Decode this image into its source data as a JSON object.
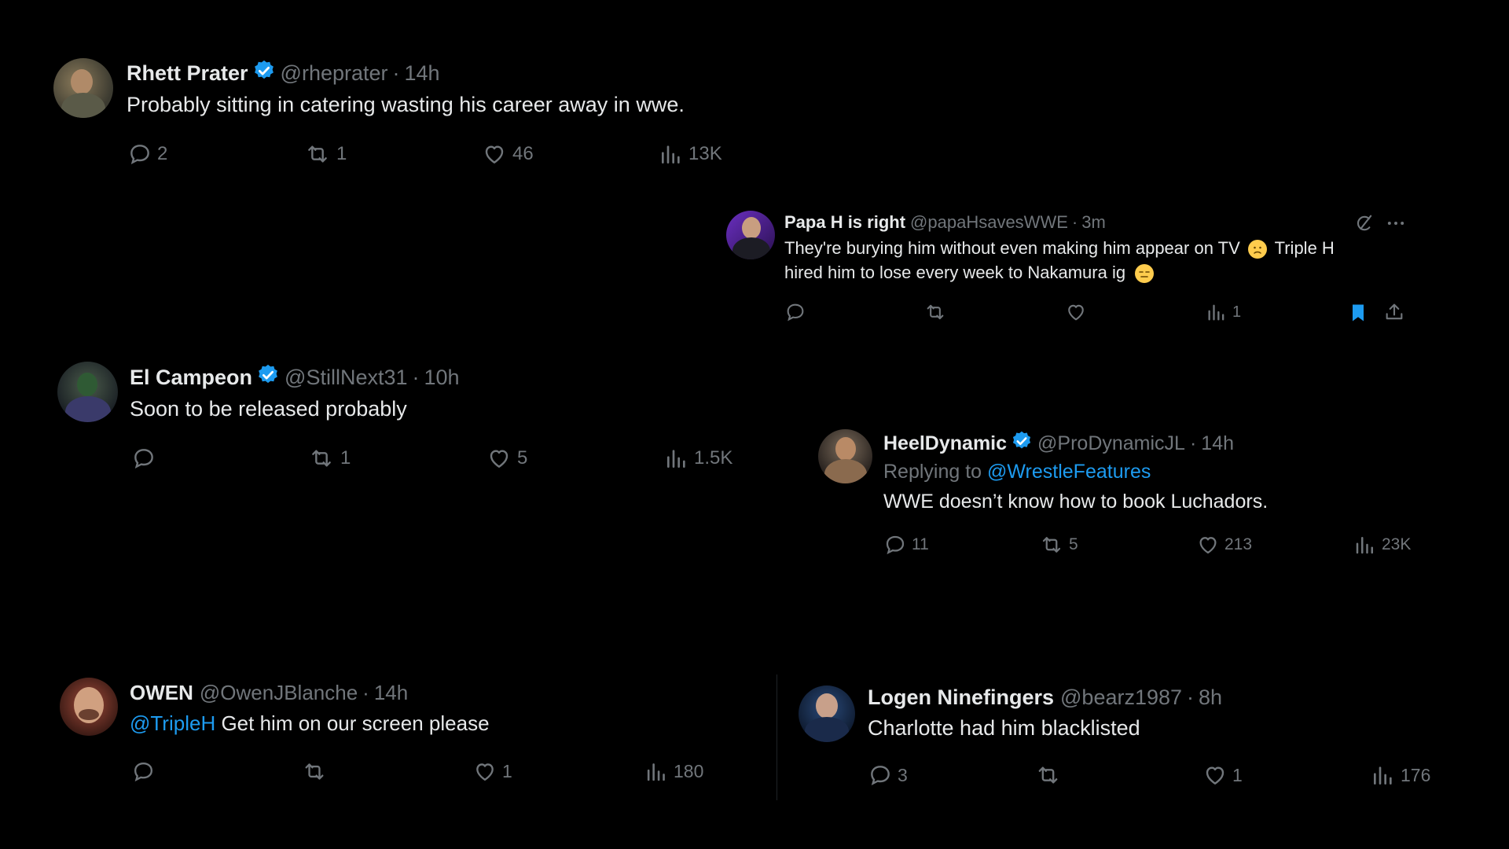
{
  "colors": {
    "background": "#000000",
    "text": "#e7e9ea",
    "muted": "#71767b",
    "accent": "#1d9bf0"
  },
  "tweets": [
    {
      "name": "Rhett Prater",
      "verified": true,
      "handle": "@rheprater",
      "sep": "·",
      "time": "14h",
      "text": "Probably sitting in catering wasting his career away in wwe.",
      "replies": "2",
      "retweets": "1",
      "likes": "46",
      "views": "13K"
    },
    {
      "name": "Papa H is right",
      "verified": false,
      "handle": "@papaHsavesWWE",
      "sep": "·",
      "time": "3m",
      "text_line1_a": "They're burying him without even making him appear on TV",
      "text_line1_b": "Triple H",
      "text_line2": "hired him to lose every week to Nakamura ig",
      "replies": "",
      "retweets": "",
      "likes": "",
      "views": "1",
      "icons": [
        "grok-icon",
        "more-icon",
        "bookmark-filled-icon",
        "share-icon"
      ]
    },
    {
      "name": "El Campeon",
      "verified": true,
      "handle": "@StillNext31",
      "sep": "·",
      "time": "10h",
      "text": "Soon to be released probably",
      "replies": "",
      "retweets": "1",
      "likes": "5",
      "views": "1.5K"
    },
    {
      "name": "HeelDynamic",
      "verified": true,
      "handle": "@ProDynamicJL",
      "sep": "·",
      "time": "14h",
      "replying_prefix": "Replying to",
      "replying_to": "@WrestleFeatures",
      "text": "WWE doesn’t know how to book Luchadors.",
      "replies": "11",
      "retweets": "5",
      "likes": "213",
      "views": "23K"
    },
    {
      "name": "OWEN",
      "verified": false,
      "handle": "@OwenJBlanche",
      "sep": "·",
      "time": "14h",
      "mention": "@TripleH",
      "text": "Get him on our screen please",
      "replies": "",
      "retweets": "",
      "likes": "1",
      "views": "180"
    },
    {
      "name": "Logen Ninefingers",
      "verified": false,
      "handle": "@bearz1987",
      "sep": "·",
      "time": "8h",
      "text": "Charlotte had him blacklisted",
      "replies": "3",
      "retweets": "",
      "likes": "1",
      "views": "176"
    }
  ]
}
